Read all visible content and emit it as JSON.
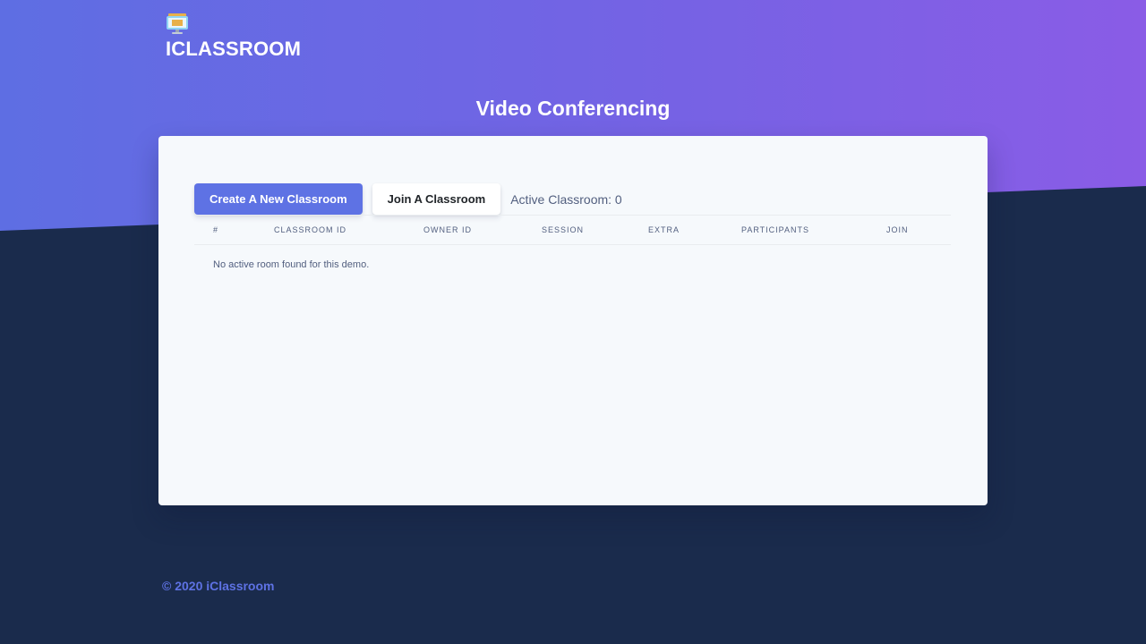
{
  "brand": {
    "name": "ICLASSROOM",
    "icon": "monitor-icon"
  },
  "page": {
    "title": "Video Conferencing"
  },
  "actions": {
    "create_label": "Create A New Classroom",
    "join_label": "Join A Classroom",
    "active_count": "Active Classroom: 0"
  },
  "table": {
    "headers": [
      "#",
      "CLASSROOM ID",
      "OWNER ID",
      "SESSION",
      "EXTRA",
      "PARTICIPANTS",
      "JOIN"
    ],
    "rows": [],
    "empty_message": "No active room found for this demo."
  },
  "footer": {
    "copyright": "© 2020 iClassroom"
  },
  "colors": {
    "primary": "#5e72e4",
    "background_dark": "#1a2b4c",
    "gradient_start": "#5e6ee3",
    "gradient_end": "#8a5ce6",
    "card": "#f6f9fc"
  }
}
